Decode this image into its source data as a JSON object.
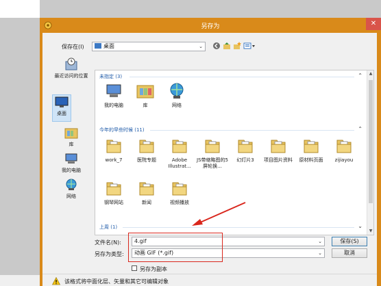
{
  "dialog": {
    "title": "另存为",
    "close_glyph": "✕"
  },
  "toolbar": {
    "save_in_label": "保存在(I)",
    "location_value": "桌面",
    "back_icon": "back-icon",
    "up_icon": "up-folder-icon",
    "new_folder_icon": "new-folder-icon",
    "view_icon": "view-menu-icon"
  },
  "places": [
    {
      "label": "最近访问的位置",
      "icon": "recent-icon"
    },
    {
      "label": "桌面",
      "icon": "desktop-icon"
    },
    {
      "label": "库",
      "icon": "library-icon"
    },
    {
      "label": "我的电脑",
      "icon": "computer-icon"
    },
    {
      "label": "网络",
      "icon": "network-icon"
    }
  ],
  "groups": [
    {
      "header": "未指定 (3)",
      "items": [
        {
          "label": "我的电脑",
          "icon": "computer-icon"
        },
        {
          "label": "库",
          "icon": "library-icon"
        },
        {
          "label": "网络",
          "icon": "network-icon"
        }
      ]
    },
    {
      "header": "今年的早些时候 (11)",
      "items": [
        {
          "label": "work_7",
          "icon": "folder-icon"
        },
        {
          "label": "医院专题",
          "icon": "folder-icon"
        },
        {
          "label": "Adobe Illustrat...",
          "icon": "folder-icon"
        },
        {
          "label": "JS带缩略图的5屏轮换...",
          "icon": "folder-icon"
        },
        {
          "label": "幻灯片3",
          "icon": "folder-icon"
        },
        {
          "label": "项目图片资料",
          "icon": "folder-icon"
        },
        {
          "label": "原材料页面",
          "icon": "folder-icon"
        },
        {
          "label": "zijiayou",
          "icon": "folder-icon"
        },
        {
          "label": "钢琴网站",
          "icon": "folder-icon"
        },
        {
          "label": "新闻",
          "icon": "folder-icon"
        },
        {
          "label": "视频播放",
          "icon": "folder-icon"
        }
      ]
    },
    {
      "header": "上周 (1)",
      "items": []
    }
  ],
  "form": {
    "filename_label": "文件名(N):",
    "filename_value": "4.gif",
    "filetype_label": "另存为类型:",
    "filetype_value": "动画 GIF (*.gif)",
    "save_button": "保存(S)",
    "cancel_button": "取消",
    "save_copy_label": "另存为副本"
  },
  "info": {
    "message": "该格式将中面化层、矢量和其它可编辑对象"
  },
  "colors": {
    "titlebar": "#d98a1a",
    "annotation": "#d9261c",
    "group_header": "#1e5aa8"
  }
}
